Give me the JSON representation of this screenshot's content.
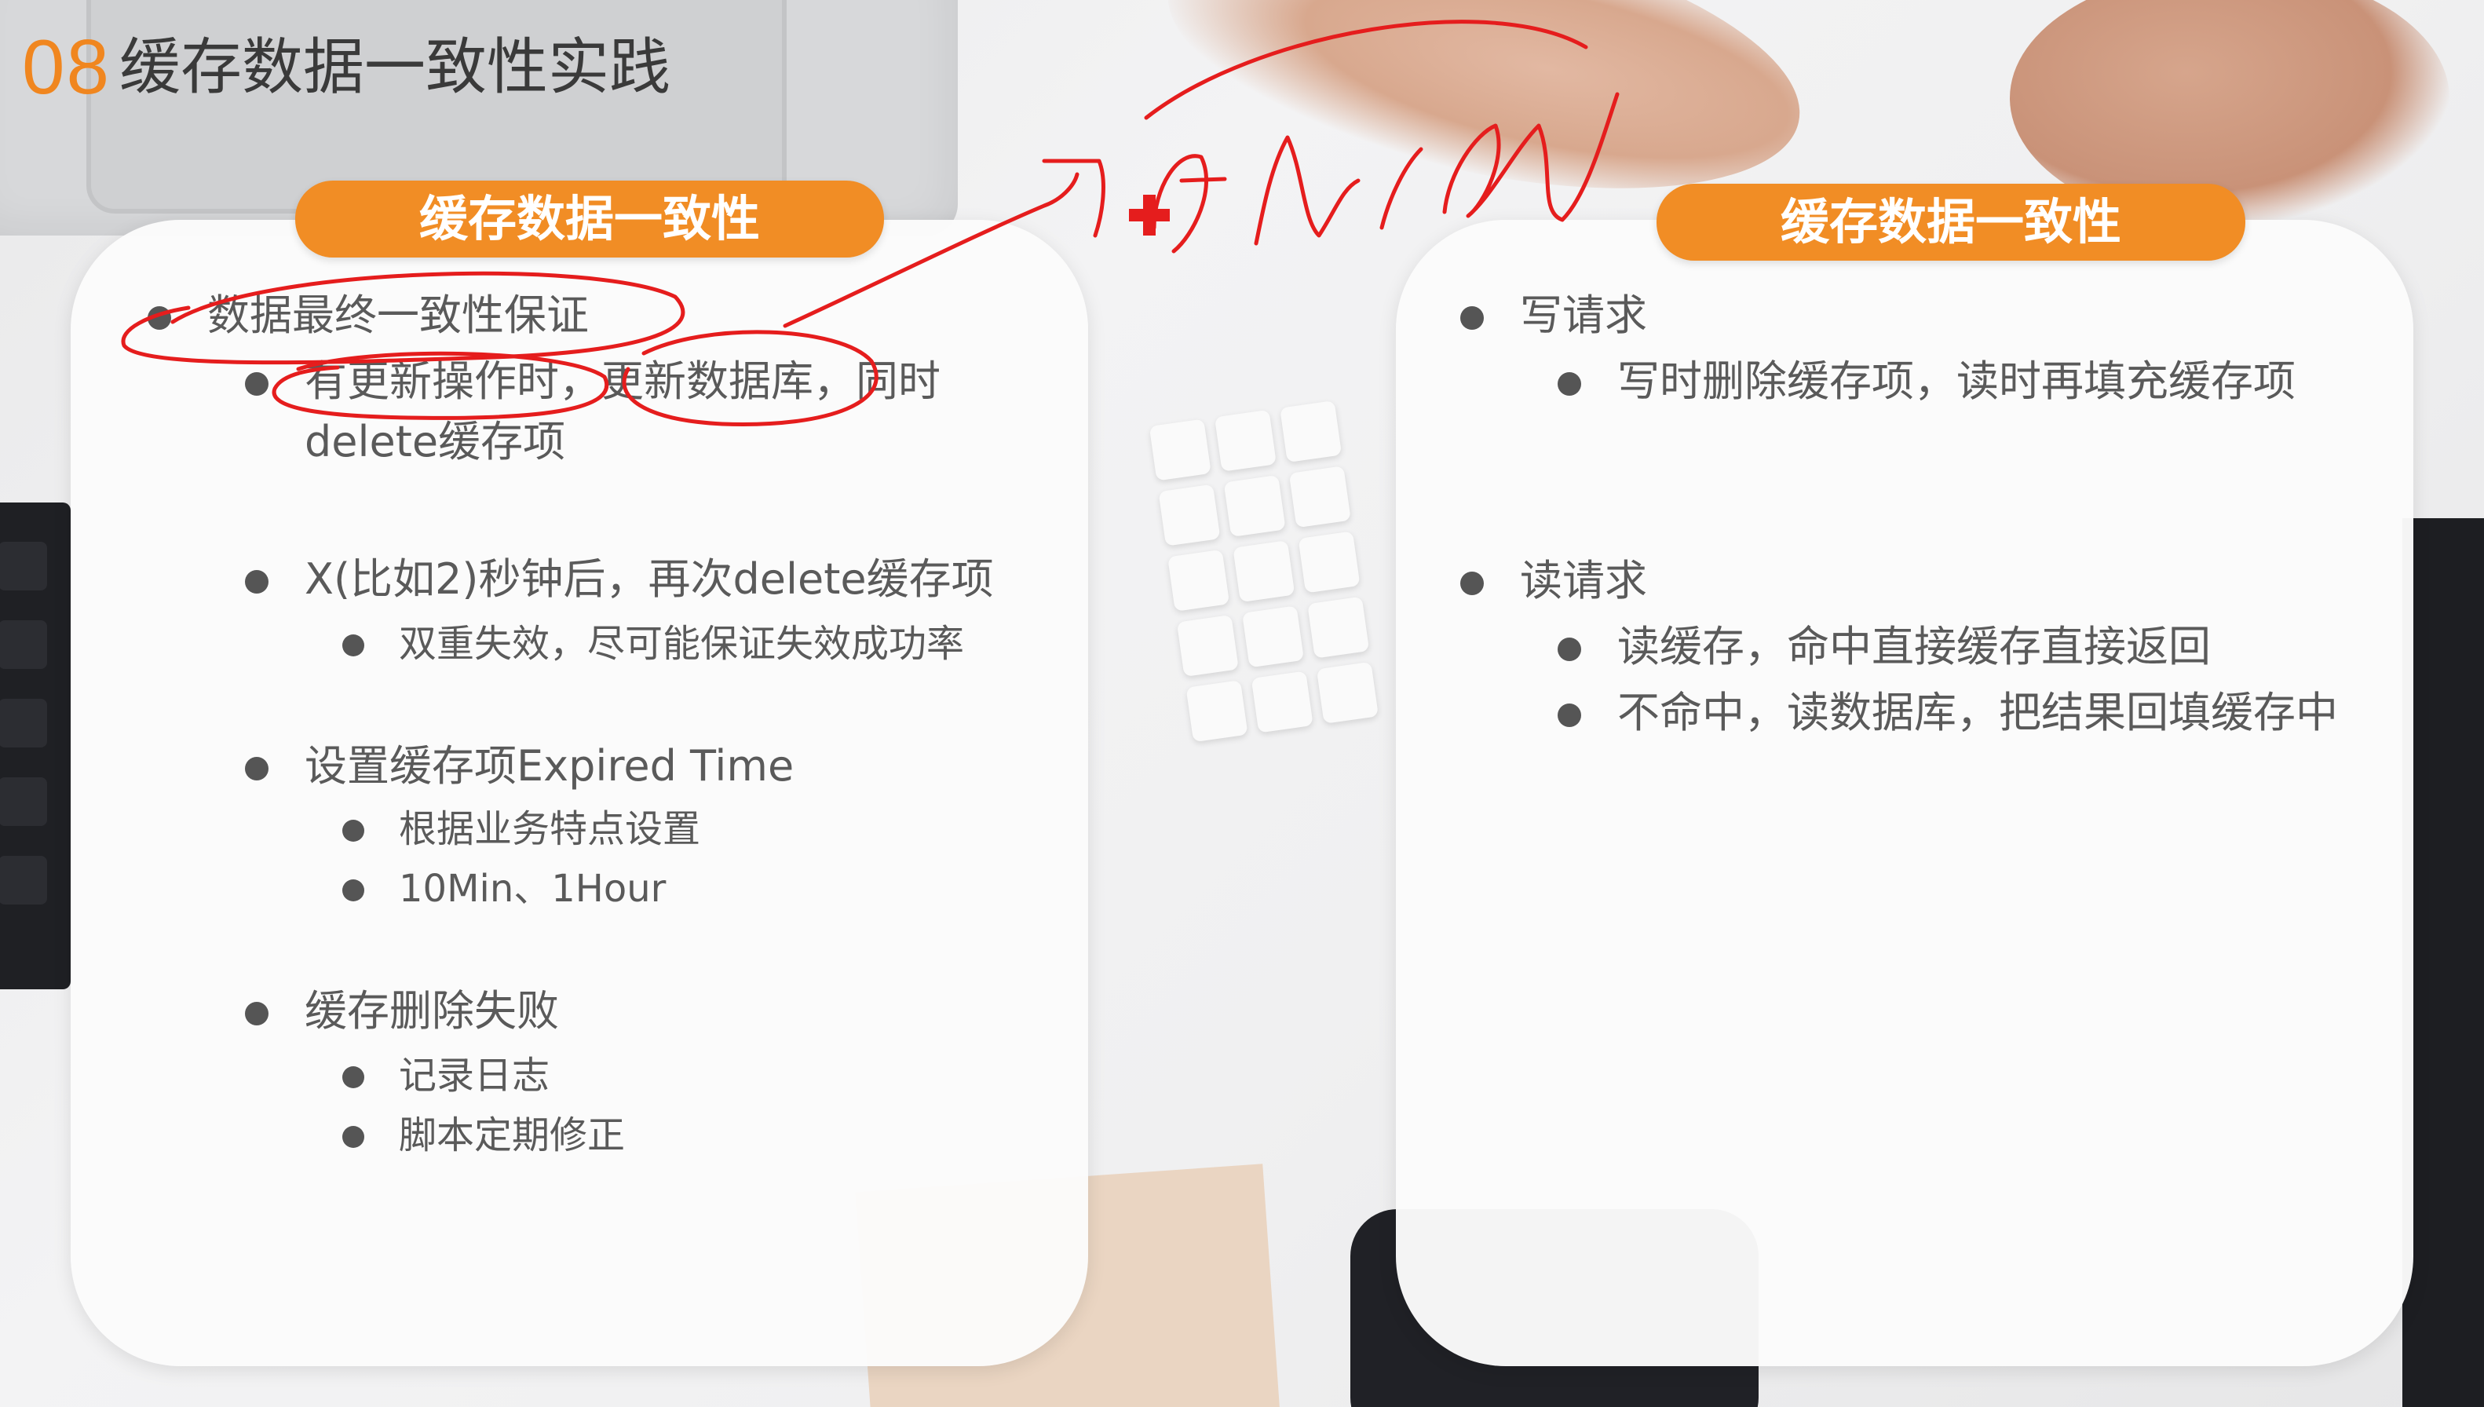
{
  "header": {
    "number": "08",
    "title": "缓存数据一致性实践"
  },
  "left_card": {
    "pill_label": "缓存数据一致性",
    "items": [
      {
        "text": "数据最终一致性保证"
      },
      {
        "text": "有更新操作时，更新数据库，同时delete缓存项"
      },
      {
        "text": "X(比如2)秒钟后，再次delete缓存项"
      },
      {
        "text": "双重失效，尽可能保证失效成功率"
      },
      {
        "text": "设置缓存项Expired Time"
      },
      {
        "text": "根据业务特点设置"
      },
      {
        "text": "10Min、1Hour"
      },
      {
        "text": "缓存删除失败"
      },
      {
        "text": "记录日志"
      },
      {
        "text": "脚本定期修正"
      }
    ]
  },
  "right_card": {
    "pill_label": "缓存数据一致性",
    "items": [
      {
        "text": "写请求"
      },
      {
        "text": "写时删除缓存项，读时再填充缓存项"
      },
      {
        "text": "读请求"
      },
      {
        "text": "读缓存，命中直接缓存直接返回"
      },
      {
        "text": "不命中，读数据库，把结果回填缓存中"
      }
    ]
  },
  "colors": {
    "accent": "#f18d25",
    "number": "#f0861f",
    "ink": "#e51d1d",
    "text": "#5a5a5a"
  }
}
